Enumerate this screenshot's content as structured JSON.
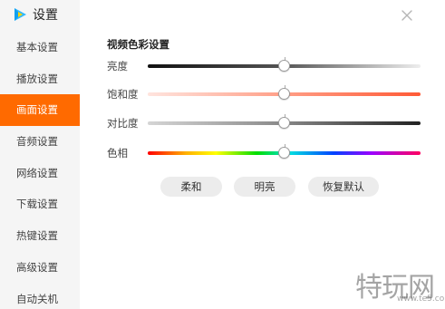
{
  "app": {
    "title": "设置",
    "logo_icon": "play-logo-icon",
    "close_icon": "close-icon"
  },
  "sidebar": {
    "items": [
      {
        "label": "基本设置",
        "active": false
      },
      {
        "label": "播放设置",
        "active": false
      },
      {
        "label": "画面设置",
        "active": true
      },
      {
        "label": "音频设置",
        "active": false
      },
      {
        "label": "网络设置",
        "active": false
      },
      {
        "label": "下载设置",
        "active": false
      },
      {
        "label": "热键设置",
        "active": false
      },
      {
        "label": "高级设置",
        "active": false
      },
      {
        "label": "自动关机",
        "active": false
      }
    ]
  },
  "main": {
    "section_title": "视频色彩设置",
    "sliders": {
      "brightness": {
        "label": "亮度",
        "value": 0.5
      },
      "saturation": {
        "label": "饱和度",
        "value": 0.5
      },
      "contrast": {
        "label": "对比度",
        "value": 0.5
      },
      "hue": {
        "label": "色相",
        "value": 0.5
      }
    },
    "presets": {
      "soft": "柔和",
      "bright": "明亮",
      "reset": "恢复默认"
    }
  },
  "watermark": {
    "text": "特玩网",
    "url": "www.te5.com"
  },
  "colors": {
    "accent": "#ff6a00",
    "sidebar_bg": "#f5f5f5"
  }
}
